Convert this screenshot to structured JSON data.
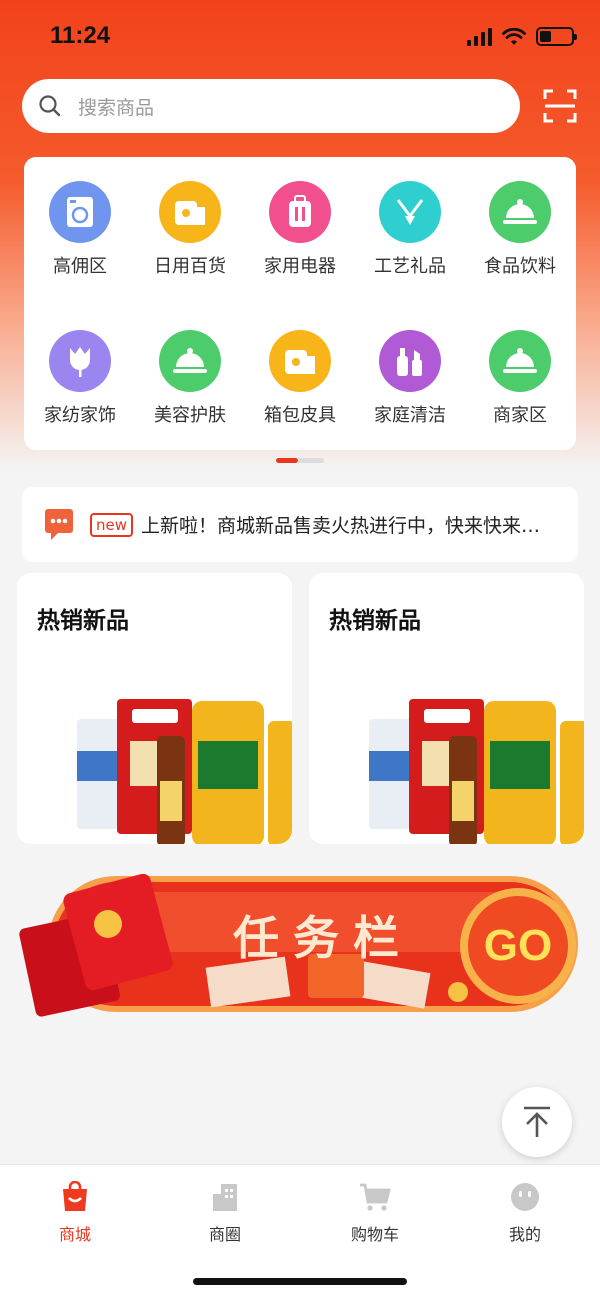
{
  "status_bar": {
    "time": "11:24"
  },
  "search": {
    "placeholder": "搜索商品"
  },
  "categories": [
    {
      "label": "高佣区",
      "icon": "washing-machine-icon",
      "color": "#6f95ef"
    },
    {
      "label": "日用百货",
      "icon": "tissue-roll-icon",
      "color": "#f7b51a"
    },
    {
      "label": "家用电器",
      "icon": "suitcase-icon",
      "color": "#f24f8e"
    },
    {
      "label": "工艺礼品",
      "icon": "necklace-icon",
      "color": "#2fcfcf"
    },
    {
      "label": "食品饮料",
      "icon": "food-cloche-icon",
      "color": "#4ccc6b"
    },
    {
      "label": "家纺家饰",
      "icon": "tulip-icon",
      "color": "#9b86f0"
    },
    {
      "label": "美容护肤",
      "icon": "food-cloche-icon",
      "color": "#4ccc6b"
    },
    {
      "label": "箱包皮具",
      "icon": "tissue-roll-icon",
      "color": "#f7b51a"
    },
    {
      "label": "家庭清洁",
      "icon": "cosmetics-icon",
      "color": "#b05ad6"
    },
    {
      "label": "商家区",
      "icon": "food-cloche-icon",
      "color": "#4ccc6b"
    }
  ],
  "notice": {
    "badge": "new",
    "text": "上新啦！商城新品售卖火热进行中，快来快来…"
  },
  "promos": [
    {
      "title": "热销新品"
    },
    {
      "title": "热销新品"
    }
  ],
  "task_banner": {
    "label": "任务栏",
    "go": "GO"
  },
  "tabs": [
    {
      "label": "商城",
      "icon": "shopping-bag-icon",
      "active": true
    },
    {
      "label": "商圈",
      "icon": "building-icon",
      "active": false
    },
    {
      "label": "购物车",
      "icon": "cart-icon",
      "active": false
    },
    {
      "label": "我的",
      "icon": "smiley-icon",
      "active": false
    }
  ],
  "colors": {
    "accent": "#e8371c",
    "hero": "#f2421c"
  }
}
